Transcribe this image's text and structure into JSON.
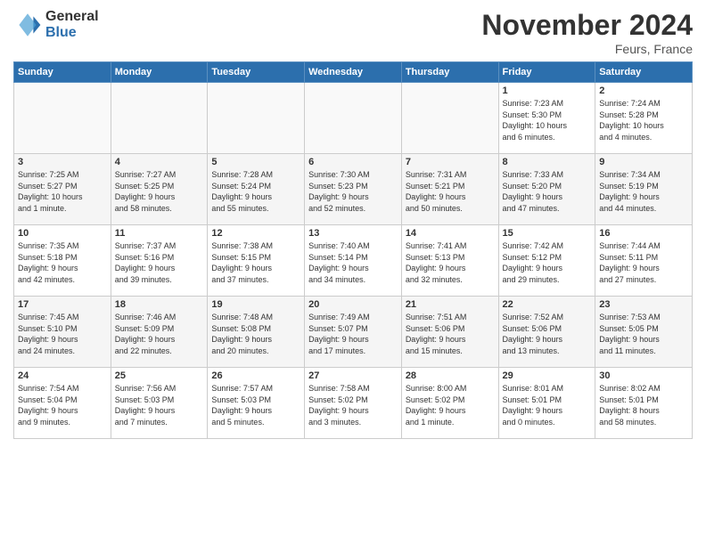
{
  "logo": {
    "general": "General",
    "blue": "Blue"
  },
  "header": {
    "month": "November 2024",
    "location": "Feurs, France"
  },
  "days_of_week": [
    "Sunday",
    "Monday",
    "Tuesday",
    "Wednesday",
    "Thursday",
    "Friday",
    "Saturday"
  ],
  "weeks": [
    [
      {
        "day": "",
        "detail": ""
      },
      {
        "day": "",
        "detail": ""
      },
      {
        "day": "",
        "detail": ""
      },
      {
        "day": "",
        "detail": ""
      },
      {
        "day": "",
        "detail": ""
      },
      {
        "day": "1",
        "detail": "Sunrise: 7:23 AM\nSunset: 5:30 PM\nDaylight: 10 hours\nand 6 minutes."
      },
      {
        "day": "2",
        "detail": "Sunrise: 7:24 AM\nSunset: 5:28 PM\nDaylight: 10 hours\nand 4 minutes."
      }
    ],
    [
      {
        "day": "3",
        "detail": "Sunrise: 7:25 AM\nSunset: 5:27 PM\nDaylight: 10 hours\nand 1 minute."
      },
      {
        "day": "4",
        "detail": "Sunrise: 7:27 AM\nSunset: 5:25 PM\nDaylight: 9 hours\nand 58 minutes."
      },
      {
        "day": "5",
        "detail": "Sunrise: 7:28 AM\nSunset: 5:24 PM\nDaylight: 9 hours\nand 55 minutes."
      },
      {
        "day": "6",
        "detail": "Sunrise: 7:30 AM\nSunset: 5:23 PM\nDaylight: 9 hours\nand 52 minutes."
      },
      {
        "day": "7",
        "detail": "Sunrise: 7:31 AM\nSunset: 5:21 PM\nDaylight: 9 hours\nand 50 minutes."
      },
      {
        "day": "8",
        "detail": "Sunrise: 7:33 AM\nSunset: 5:20 PM\nDaylight: 9 hours\nand 47 minutes."
      },
      {
        "day": "9",
        "detail": "Sunrise: 7:34 AM\nSunset: 5:19 PM\nDaylight: 9 hours\nand 44 minutes."
      }
    ],
    [
      {
        "day": "10",
        "detail": "Sunrise: 7:35 AM\nSunset: 5:18 PM\nDaylight: 9 hours\nand 42 minutes."
      },
      {
        "day": "11",
        "detail": "Sunrise: 7:37 AM\nSunset: 5:16 PM\nDaylight: 9 hours\nand 39 minutes."
      },
      {
        "day": "12",
        "detail": "Sunrise: 7:38 AM\nSunset: 5:15 PM\nDaylight: 9 hours\nand 37 minutes."
      },
      {
        "day": "13",
        "detail": "Sunrise: 7:40 AM\nSunset: 5:14 PM\nDaylight: 9 hours\nand 34 minutes."
      },
      {
        "day": "14",
        "detail": "Sunrise: 7:41 AM\nSunset: 5:13 PM\nDaylight: 9 hours\nand 32 minutes."
      },
      {
        "day": "15",
        "detail": "Sunrise: 7:42 AM\nSunset: 5:12 PM\nDaylight: 9 hours\nand 29 minutes."
      },
      {
        "day": "16",
        "detail": "Sunrise: 7:44 AM\nSunset: 5:11 PM\nDaylight: 9 hours\nand 27 minutes."
      }
    ],
    [
      {
        "day": "17",
        "detail": "Sunrise: 7:45 AM\nSunset: 5:10 PM\nDaylight: 9 hours\nand 24 minutes."
      },
      {
        "day": "18",
        "detail": "Sunrise: 7:46 AM\nSunset: 5:09 PM\nDaylight: 9 hours\nand 22 minutes."
      },
      {
        "day": "19",
        "detail": "Sunrise: 7:48 AM\nSunset: 5:08 PM\nDaylight: 9 hours\nand 20 minutes."
      },
      {
        "day": "20",
        "detail": "Sunrise: 7:49 AM\nSunset: 5:07 PM\nDaylight: 9 hours\nand 17 minutes."
      },
      {
        "day": "21",
        "detail": "Sunrise: 7:51 AM\nSunset: 5:06 PM\nDaylight: 9 hours\nand 15 minutes."
      },
      {
        "day": "22",
        "detail": "Sunrise: 7:52 AM\nSunset: 5:06 PM\nDaylight: 9 hours\nand 13 minutes."
      },
      {
        "day": "23",
        "detail": "Sunrise: 7:53 AM\nSunset: 5:05 PM\nDaylight: 9 hours\nand 11 minutes."
      }
    ],
    [
      {
        "day": "24",
        "detail": "Sunrise: 7:54 AM\nSunset: 5:04 PM\nDaylight: 9 hours\nand 9 minutes."
      },
      {
        "day": "25",
        "detail": "Sunrise: 7:56 AM\nSunset: 5:03 PM\nDaylight: 9 hours\nand 7 minutes."
      },
      {
        "day": "26",
        "detail": "Sunrise: 7:57 AM\nSunset: 5:03 PM\nDaylight: 9 hours\nand 5 minutes."
      },
      {
        "day": "27",
        "detail": "Sunrise: 7:58 AM\nSunset: 5:02 PM\nDaylight: 9 hours\nand 3 minutes."
      },
      {
        "day": "28",
        "detail": "Sunrise: 8:00 AM\nSunset: 5:02 PM\nDaylight: 9 hours\nand 1 minute."
      },
      {
        "day": "29",
        "detail": "Sunrise: 8:01 AM\nSunset: 5:01 PM\nDaylight: 9 hours\nand 0 minutes."
      },
      {
        "day": "30",
        "detail": "Sunrise: 8:02 AM\nSunset: 5:01 PM\nDaylight: 8 hours\nand 58 minutes."
      }
    ]
  ]
}
